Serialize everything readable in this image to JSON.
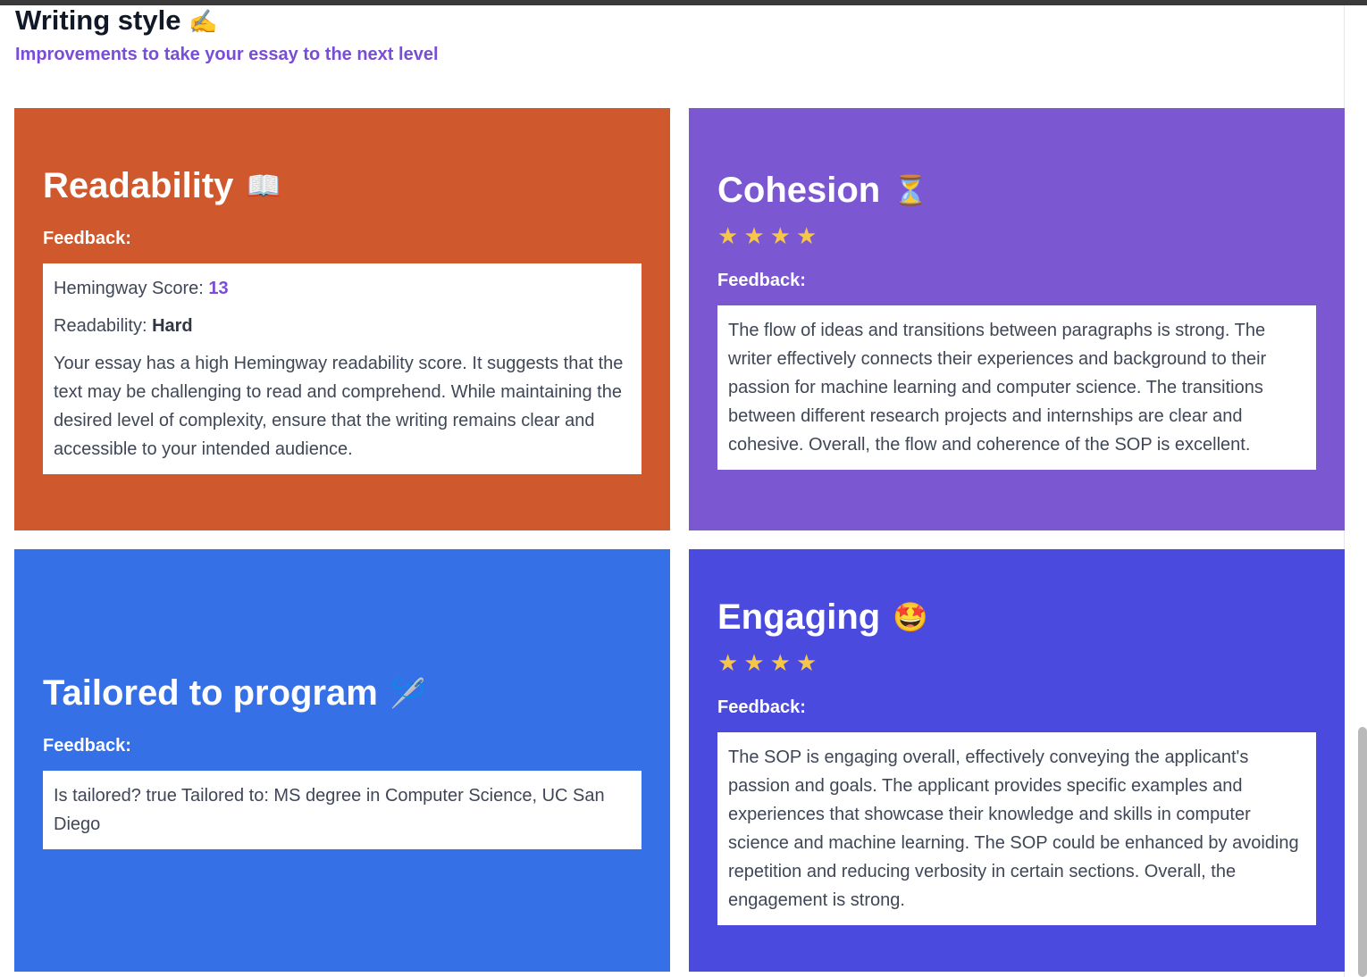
{
  "header": {
    "title": "Writing style",
    "title_icon": "✍️",
    "subtitle": "Improvements to take your essay to the next level"
  },
  "colors": {
    "readability": "#cf592c",
    "cohesion": "#7b57d2",
    "tailored": "#3570e6",
    "engaging": "#4a4adf",
    "star": "#f6c64a",
    "accent": "#7a4dd6"
  },
  "readability": {
    "title": "Readability",
    "icon": "📖",
    "feedback_label": "Feedback:",
    "score_label": "Hemingway Score:",
    "score_value": "13",
    "level_label": "Readability:",
    "level_value": "Hard",
    "text": "Your essay has a high Hemingway readability score. It suggests that the text may be challenging to read and comprehend. While maintaining the desired level of complexity, ensure that the writing remains clear and accessible to your intended audience."
  },
  "cohesion": {
    "title": "Cohesion",
    "icon": "⏳",
    "rating": 4,
    "feedback_label": "Feedback:",
    "text": "The flow of ideas and transitions between paragraphs is strong. The writer effectively connects their experiences and background to their passion for machine learning and computer science. The transitions between different research projects and internships are clear and cohesive. Overall, the flow and coherence of the SOP is excellent."
  },
  "tailored": {
    "title": "Tailored to program",
    "icon": "🪡",
    "feedback_label": "Feedback:",
    "text": "Is tailored? true Tailored to: MS degree in Computer Science, UC San Diego"
  },
  "engaging": {
    "title": "Engaging",
    "icon": "🤩",
    "rating": 4,
    "feedback_label": "Feedback:",
    "text": "The SOP is engaging overall, effectively conveying the applicant's passion and goals. The applicant provides specific examples and experiences that showcase their knowledge and skills in computer science and machine learning. The SOP could be enhanced by avoiding repetition and reducing verbosity in certain sections. Overall, the engagement is strong."
  }
}
